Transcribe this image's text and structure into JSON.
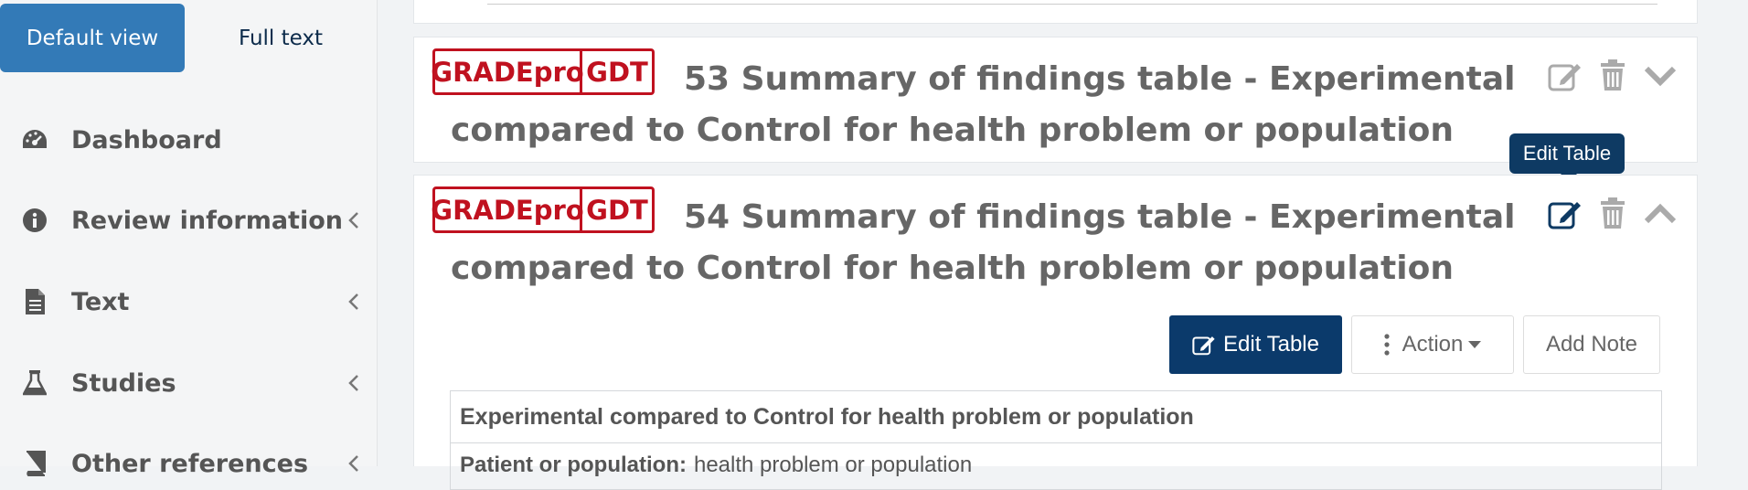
{
  "sidebar": {
    "view_toggle": {
      "default_label": "Default view",
      "full_label": "Full text"
    },
    "items": [
      {
        "label": "Dashboard",
        "icon": "dashboard-icon",
        "has_chevron": false
      },
      {
        "label": "Review information",
        "icon": "info-circle-icon",
        "has_chevron": true
      },
      {
        "label": "Text",
        "icon": "document-icon",
        "has_chevron": true
      },
      {
        "label": "Studies",
        "icon": "flask-icon",
        "has_chevron": true
      },
      {
        "label": "Other references",
        "icon": "book-icon",
        "has_chevron": true
      }
    ]
  },
  "panels": [
    {
      "logo_left": "GRADEpro",
      "logo_right": "GDT",
      "title": "53 Summary of findings table - Experimental compared to Control for health problem or population",
      "expanded": false
    },
    {
      "logo_left": "GRADEpro",
      "logo_right": "GDT",
      "title": "54 Summary of findings table - Experimental compared to Control for health problem or population",
      "expanded": true
    }
  ],
  "tooltip": "Edit Table",
  "actions": {
    "edit": "Edit Table",
    "action": "Action",
    "note": "Add Note"
  },
  "sof": {
    "heading": "Experimental compared to Control for health problem or population",
    "row_label": "Patient or population:",
    "row_value": "health problem or population"
  },
  "colors": {
    "accent": "#337ab7",
    "primary": "#0b3a6b",
    "brand_red": "#c0111f"
  }
}
